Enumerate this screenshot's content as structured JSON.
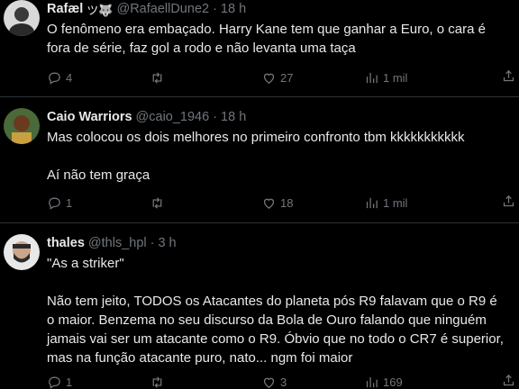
{
  "tweets": [
    {
      "name": "Rafæl",
      "emoji": "ツ🐺",
      "handle": "@RafaellDune2",
      "separator": "·",
      "time": "18 h",
      "lines": [
        "O fenômeno era embaçado. Harry Kane tem que ganhar a Euro, o cara é",
        "fora de série, faz gol a rodo e não levanta uma taça"
      ],
      "reply_count": "4",
      "retweet_count": "",
      "like_count": "27",
      "view_count": "1 mil"
    },
    {
      "name": "Caio Warriors",
      "handle": "@caio_1946",
      "separator": "·",
      "time": "18 h",
      "lines": [
        "Mas colocou os dois melhores no primeiro confronto tbm kkkkkkkkkkk",
        "",
        "Aí não tem graça"
      ],
      "reply_count": "1",
      "retweet_count": "",
      "like_count": "18",
      "view_count": "1 mil"
    },
    {
      "name": "thales",
      "handle": "@thls_hpl",
      "separator": "·",
      "time": "3 h",
      "lines": [
        "\"As a striker\"",
        "",
        "Não tem jeito, TODOS os Atacantes do planeta pós R9 falavam que o R9 é",
        "o maior. Benzema no seu discurso da Bola de Ouro falando que ninguém",
        "jamais vai ser um atacante como o R9. Óbvio que no todo o CR7 é superior,",
        "mas na função atacante puro, nato... ngm foi maior"
      ],
      "reply_count": "1",
      "retweet_count": "",
      "like_count": "3",
      "view_count": "169"
    }
  ],
  "icons": {
    "reply": "reply-icon",
    "retweet": "retweet-icon",
    "like": "like-icon",
    "views": "views-icon",
    "share": "share-icon"
  },
  "colors": {
    "background": "#000000",
    "text": "#e7e9ea",
    "muted": "#71767b",
    "divider": "#2f3336"
  }
}
